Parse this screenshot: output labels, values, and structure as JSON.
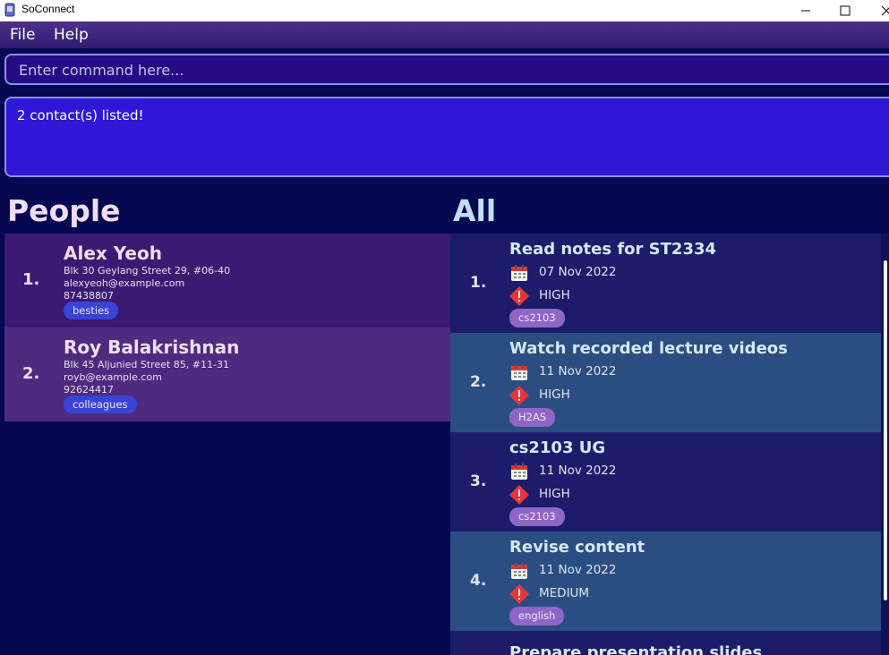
{
  "window": {
    "title": "SoConnect"
  },
  "menu": {
    "items": [
      "File",
      "Help"
    ]
  },
  "command": {
    "placeholder": "Enter command here..."
  },
  "result": {
    "text": "2 contact(s) listed!"
  },
  "people_panel": {
    "heading": "People",
    "persons": [
      {
        "index": "1.",
        "name": "Alex Yeoh",
        "address": "Blk 30 Geylang Street 29, #06-40",
        "email": "alexyeoh@example.com",
        "phone": "87438807",
        "tag": "besties"
      },
      {
        "index": "2.",
        "name": "Roy Balakrishnan",
        "address": "Blk 45 Aljunied Street 85, #11-31",
        "email": "royb@example.com",
        "phone": "92624417",
        "tag": "colleagues"
      }
    ]
  },
  "tasks_panel": {
    "heading": "All",
    "tasks": [
      {
        "index": "1.",
        "title": "Read notes for ST2334",
        "date": "07 Nov 2022",
        "priority": "HIGH",
        "tag": "cs2103"
      },
      {
        "index": "2.",
        "title": "Watch recorded lecture videos",
        "date": "11 Nov 2022",
        "priority": "HIGH",
        "tag": "H2AS"
      },
      {
        "index": "3.",
        "title": "cs2103 UG",
        "date": "11 Nov 2022",
        "priority": "HIGH",
        "tag": "cs2103"
      },
      {
        "index": "4.",
        "title": "Revise content",
        "date": "11 Nov 2022",
        "priority": "MEDIUM",
        "tag": "english"
      }
    ],
    "partial_task_title": "Prepare presentation slides"
  },
  "icons": {
    "calendar": "calendar-icon",
    "priority": "priority-warning-icon"
  },
  "colors": {
    "background": "#060852",
    "result_box": "#2f17d8",
    "command_box": "#270a86",
    "task_tag": "#8f66c8",
    "person_tag": "#3944d6",
    "priority_red": "#e8353a"
  }
}
